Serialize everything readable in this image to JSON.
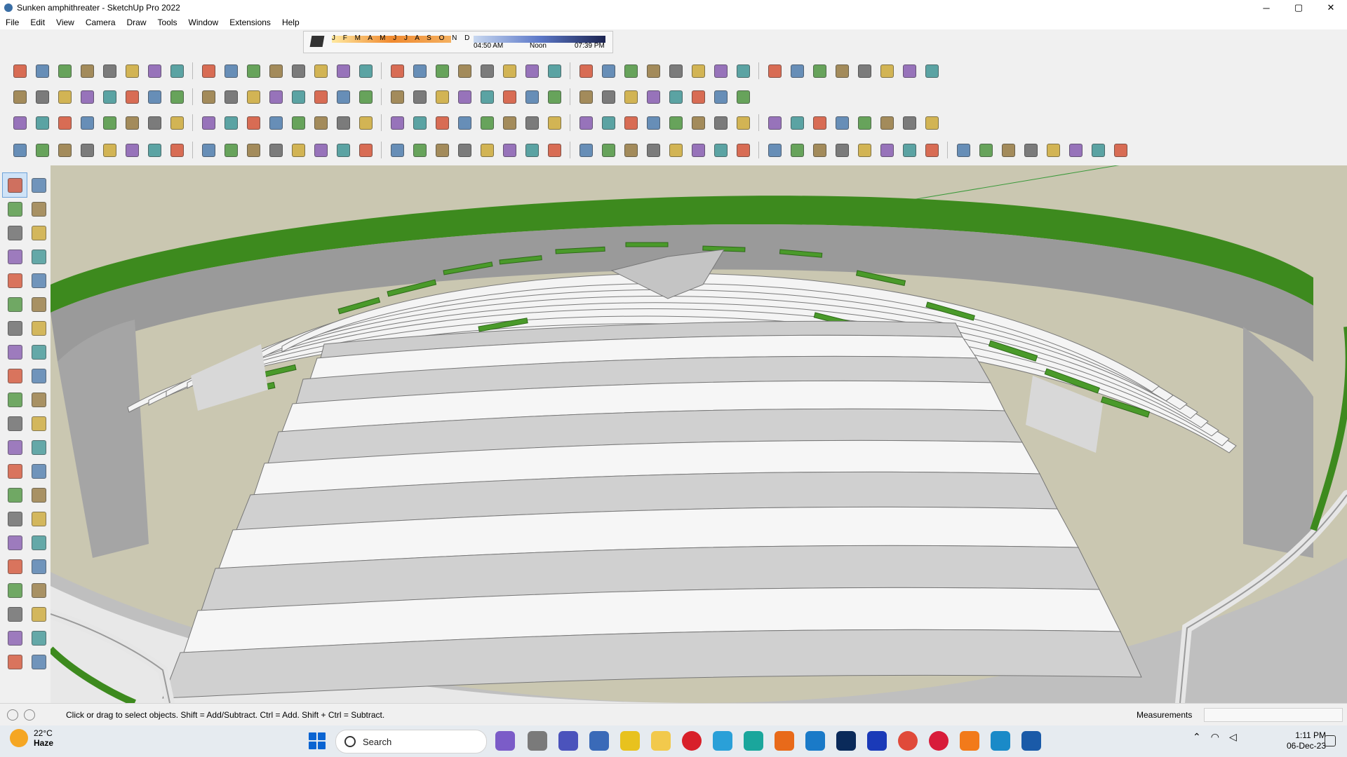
{
  "window": {
    "title": "Sunken amphithreater - SketchUp Pro 2022",
    "app_icon": "sketchup-logo-icon",
    "controls": {
      "minimize": "─",
      "maximize": "▢",
      "close": "✕"
    }
  },
  "menu": [
    "File",
    "Edit",
    "View",
    "Camera",
    "Draw",
    "Tools",
    "Window",
    "Extensions",
    "Help"
  ],
  "shadows": {
    "months": "J F M A M J J A S O N D",
    "sunrise": "04:50 AM",
    "noon": "Noon",
    "sunset": "07:39 PM"
  },
  "toolbar_rows": [
    {
      "count": 40
    },
    {
      "count": 32
    },
    {
      "count": 40
    },
    {
      "count": 48
    }
  ],
  "left_toolbar": {
    "tools": [
      "select",
      "orbit",
      "paint-bucket",
      "eraser",
      "component",
      "tape-measure",
      "line",
      "freehand",
      "rectangle",
      "rotated-rectangle",
      "circle",
      "polygon",
      "arc",
      "two-point-arc",
      "pie",
      "three-point-arc",
      "move",
      "push-pull",
      "rotate",
      "follow-me",
      "scale",
      "offset",
      "tape",
      "dimension",
      "protractor",
      "text",
      "axes",
      "3d-text",
      "orbit-cam",
      "pan",
      "zoom",
      "zoom-window",
      "zoom-extents",
      "previous-view",
      "position-camera",
      "look-around",
      "walk",
      "section-plane",
      "layer-1",
      "layer-2",
      "layer-3",
      "layer-4"
    ]
  },
  "viewport": {
    "background": "#cac7b1",
    "model": "sunken-amphitheater",
    "accent_green": "#3e8e1e",
    "seat_white": "#ffffff",
    "step_gray": "#c8c8c8"
  },
  "status": {
    "message": "Click or drag to select objects. Shift = Add/Subtract. Ctrl = Add. Shift + Ctrl = Subtract.",
    "measurements_label": "Measurements",
    "measurements_value": ""
  },
  "taskbar": {
    "weather": {
      "temp": "22°C",
      "condition": "Haze"
    },
    "search_placeholder": "Search",
    "clock": {
      "time": "1:11 PM",
      "date": "06-Dec-23"
    }
  }
}
